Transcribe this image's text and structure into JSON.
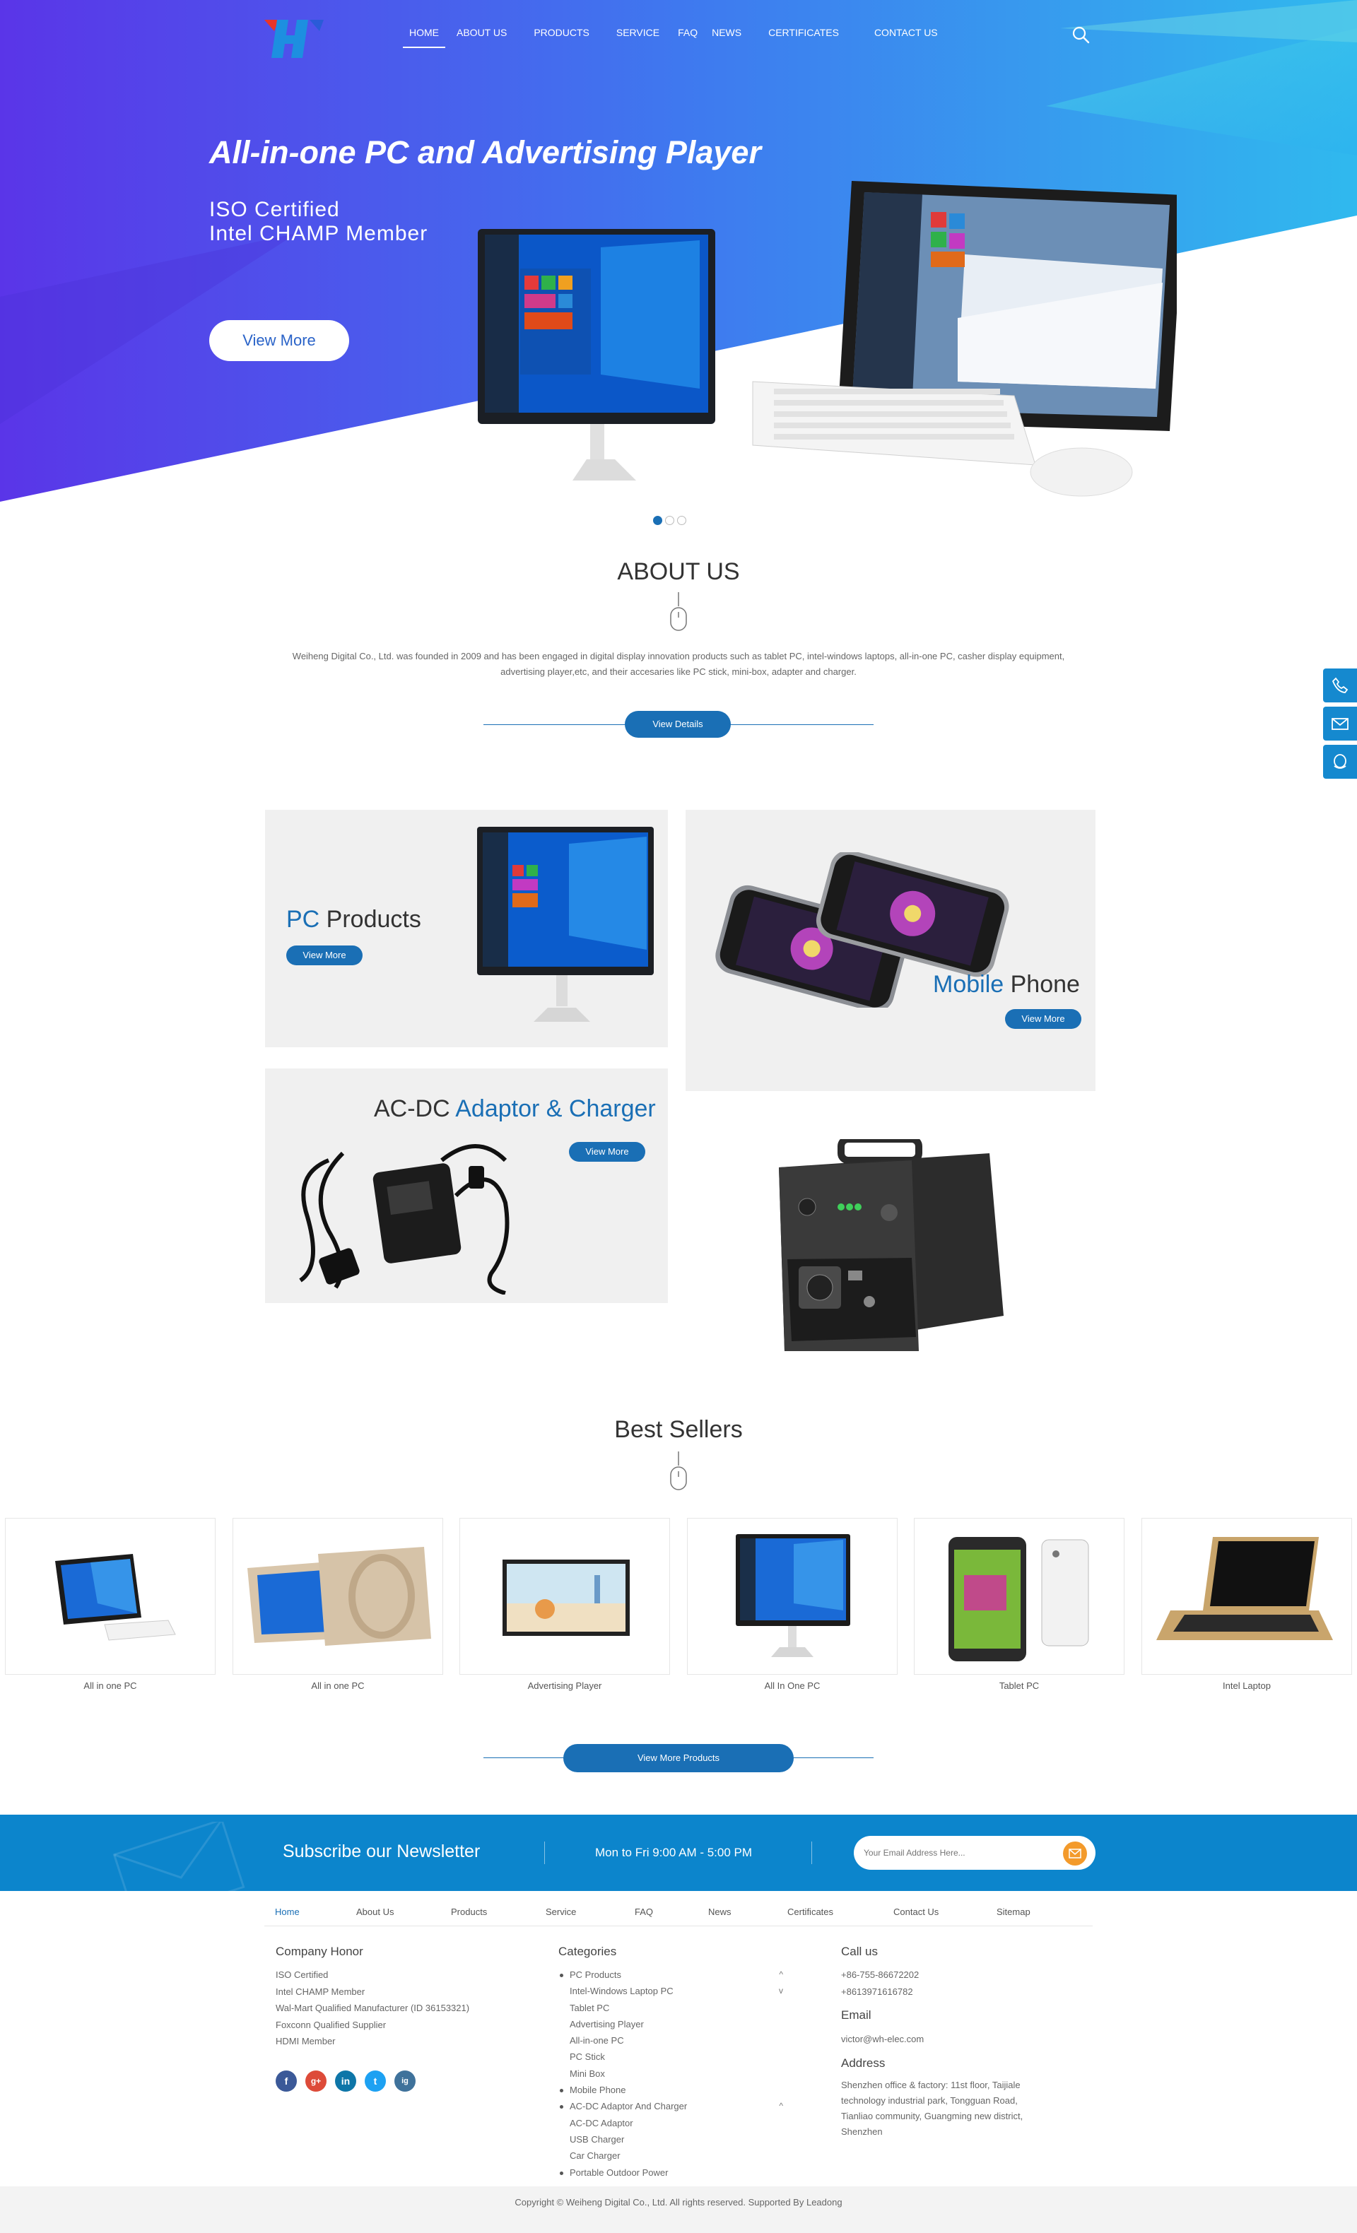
{
  "nav": {
    "items": [
      {
        "label": "HOME",
        "active": true
      },
      {
        "label": "ABOUT US"
      },
      {
        "label": "PRODUCTS"
      },
      {
        "label": "SERVICE"
      },
      {
        "label": "FAQ"
      },
      {
        "label": "NEWS"
      },
      {
        "label": "CERTIFICATES"
      },
      {
        "label": "CONTACT US"
      }
    ],
    "search_icon": "search-icon"
  },
  "hero": {
    "title": "All-in-one PC and Advertising Player",
    "subtitle_1": "ISO Certified",
    "subtitle_2": "Intel CHAMP Member",
    "button": "View More",
    "slides": 3,
    "active_slide": 1
  },
  "about": {
    "title": "ABOUT US",
    "text": "Weiheng Digital Co., Ltd. was founded in 2009 and has been engaged in digital display innovation products such as tablet PC, intel-windows laptops, all-in-one PC, casher display equipment, advertising player,etc, and their accesaries like PC stick, mini-box, adapter and charger.",
    "button": "View Details"
  },
  "categories": {
    "pc": {
      "title_accent": "PC",
      "title_rest": " Products",
      "button": "View More"
    },
    "phone": {
      "title_accent": "Mobile",
      "title_rest": " Phone",
      "button": "View More"
    },
    "adaptor": {
      "title_1": "AC-DC ",
      "title_accent_1": "Adaptor",
      "title_2": " & ",
      "title_accent_2": "Charger",
      "button": "View More"
    }
  },
  "best_sellers": {
    "title": "Best Sellers",
    "products": [
      {
        "name": "All in one PC"
      },
      {
        "name": "All in one PC"
      },
      {
        "name": "Advertising Player"
      },
      {
        "name": "All In One PC"
      },
      {
        "name": "Tablet PC"
      },
      {
        "name": "Intel Laptop"
      }
    ],
    "button": "View More Products"
  },
  "newsletter": {
    "title": "Subscribe our Newsletter",
    "hours": "Mon to Fri 9:00 AM - 5:00 PM",
    "placeholder": "Your Email Address Here..."
  },
  "footer_nav": [
    "Home",
    "About Us",
    "Products",
    "Service",
    "FAQ",
    "News",
    "Certificates",
    "Contact Us",
    "Sitemap"
  ],
  "honor": {
    "title": "Company Honor",
    "items": [
      "ISO Certified",
      "Intel CHAMP Member",
      "Wal-Mart Qualified Manufacturer (ID 36153321)",
      "Foxconn Qualified Supplier",
      "HDMI Member"
    ]
  },
  "categories_list": {
    "title": "Categories",
    "rows": [
      {
        "label": "PC Products",
        "type": "parent",
        "chevron": "^"
      },
      {
        "label": "Intel-Windows Laptop PC",
        "type": "child",
        "chevron": "v"
      },
      {
        "label": "Tablet PC",
        "type": "child"
      },
      {
        "label": "Advertising Player",
        "type": "child"
      },
      {
        "label": "All-in-one PC",
        "type": "child"
      },
      {
        "label": "PC Stick",
        "type": "child"
      },
      {
        "label": "Mini Box",
        "type": "child"
      },
      {
        "label": "Mobile Phone",
        "type": "parent"
      },
      {
        "label": "AC-DC Adaptor And Charger",
        "type": "parent",
        "chevron": "^"
      },
      {
        "label": "AC-DC Adaptor",
        "type": "child"
      },
      {
        "label": "USB Charger",
        "type": "child"
      },
      {
        "label": "Car Charger",
        "type": "child"
      },
      {
        "label": "Portable Outdoor Power",
        "type": "parent"
      }
    ]
  },
  "contact": {
    "call_title": "Call us",
    "phones": [
      "+86-755-86672202",
      "+8613971616782"
    ],
    "email_title": "Email",
    "email": "victor@wh-elec.com",
    "address_title": "Address",
    "address": [
      "Shenzhen office & factory: 11st floor, Taijiale",
      "technology industrial park, Tongguan Road,",
      "Tianliao community, Guangming new district,",
      "Shenzhen"
    ]
  },
  "social": [
    "f",
    "g+",
    "in",
    "t",
    "ig"
  ],
  "copyright": "Copyright © Weiheng Digital Co., Ltd. All rights reserved.   Supported By Leadong",
  "colors": {
    "accent": "#1a6fb5",
    "newsletter": "#0c85cc",
    "hero_start": "#5a35e8",
    "hero_end": "#2aa6f0"
  }
}
